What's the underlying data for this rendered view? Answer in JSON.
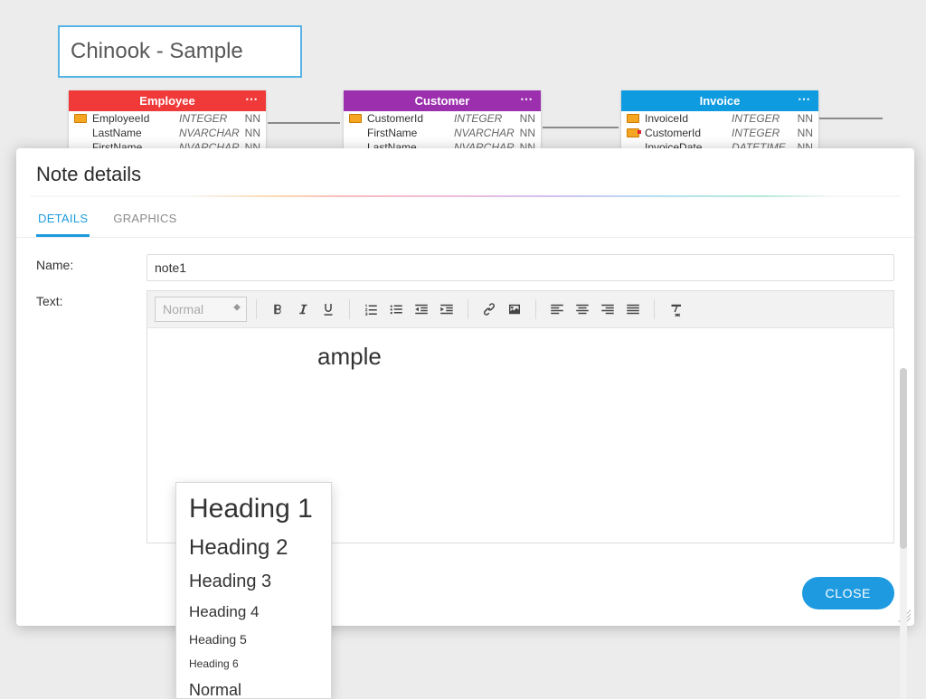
{
  "canvas": {
    "note_text": "Chinook - Sample"
  },
  "tables": {
    "employee": {
      "title": "Employee",
      "rows": [
        {
          "name": "EmployeeId",
          "type": "INTEGER",
          "nn": "NN",
          "key": "pk"
        },
        {
          "name": "LastName",
          "type": "NVARCHAR",
          "nn": "NN",
          "key": ""
        },
        {
          "name": "FirstName",
          "type": "NVARCHAR",
          "nn": "NN",
          "key": ""
        }
      ]
    },
    "customer": {
      "title": "Customer",
      "rows": [
        {
          "name": "CustomerId",
          "type": "INTEGER",
          "nn": "NN",
          "key": "pk"
        },
        {
          "name": "FirstName",
          "type": "NVARCHAR",
          "nn": "NN",
          "key": ""
        },
        {
          "name": "LastName",
          "type": "NVARCHAR",
          "nn": "NN",
          "key": ""
        }
      ]
    },
    "invoice": {
      "title": "Invoice",
      "rows": [
        {
          "name": "InvoiceId",
          "type": "INTEGER",
          "nn": "NN",
          "key": "pk"
        },
        {
          "name": "CustomerId",
          "type": "INTEGER",
          "nn": "NN",
          "key": "fk"
        },
        {
          "name": "InvoiceDate",
          "type": "DATETIME",
          "nn": "NN",
          "key": ""
        }
      ]
    }
  },
  "modal": {
    "title": "Note details",
    "tabs": {
      "details": "DETAILS",
      "graphics": "GRAPHICS"
    },
    "labels": {
      "name": "Name:",
      "text": "Text:"
    },
    "name_value": "note1",
    "editor_content": "ample",
    "close": "CLOSE",
    "format_selected": "Normal"
  },
  "heading_menu": {
    "h1": "Heading 1",
    "h2": "Heading 2",
    "h3": "Heading 3",
    "h4": "Heading 4",
    "h5": "Heading 5",
    "h6": "Heading 6",
    "normal": "Normal"
  },
  "icons": {
    "bold": "bold-icon",
    "italic": "italic-icon",
    "underline": "underline-icon",
    "ol": "ordered-list-icon",
    "ul": "unordered-list-icon",
    "outdent": "outdent-icon",
    "indent": "indent-icon",
    "link": "link-icon",
    "image": "image-icon",
    "align_left": "align-left-icon",
    "align_center": "align-center-icon",
    "align_right": "align-right-icon",
    "align_justify": "align-justify-icon",
    "clear": "clear-format-icon"
  }
}
